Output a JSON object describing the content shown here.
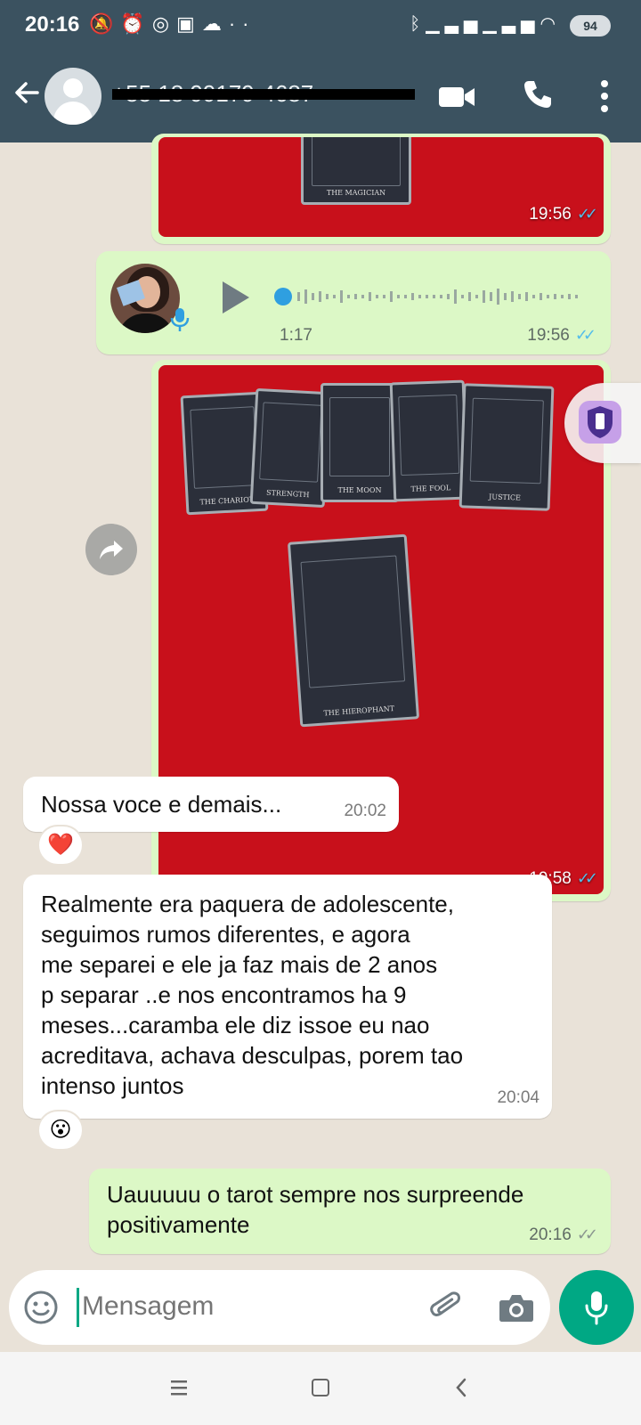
{
  "status_bar": {
    "time": "20:16",
    "battery": "94",
    "left_icons": [
      "bell-off-icon",
      "alarm-icon",
      "whatsapp-icon",
      "instagram-icon",
      "cloud-icon",
      "more-dots-icon"
    ],
    "right_icons": [
      "bluetooth-icon",
      "signal-icon",
      "signal-icon",
      "wifi-icon"
    ]
  },
  "header": {
    "contact_name": "+55 18 99179-4687",
    "icons": [
      "back-arrow-icon",
      "video-call-icon",
      "phone-call-icon",
      "more-vertical-icon"
    ]
  },
  "messages": [
    {
      "type": "image",
      "direction": "out",
      "time": "19:56",
      "status": "read",
      "card_labels": [
        "THE MAGICIAN"
      ]
    },
    {
      "type": "audio",
      "direction": "out",
      "duration": "1:17",
      "time": "19:56",
      "status": "read"
    },
    {
      "type": "image",
      "direction": "out",
      "time": "19:58",
      "status": "read",
      "card_labels": [
        "THE CHARIOT",
        "STRENGTH",
        "THE MOON",
        "THE FOOL",
        "JUSTICE",
        "THE HIEROPHANT"
      ]
    },
    {
      "type": "text",
      "direction": "in",
      "text": "Nossa voce e demais...",
      "time": "20:02",
      "reaction": "❤️"
    },
    {
      "type": "text",
      "direction": "in",
      "lines": [
        "Realmente era paquera de adolescente,",
        "seguimos rumos diferentes, e agora",
        "me separei e ele ja faz mais de 2 anos",
        "p separar ..e nos encontramos ha 9",
        "meses...caramba ele diz issoe eu nao",
        "acreditava, achava desculpas, porem tao",
        "intenso juntos"
      ],
      "time": "20:04",
      "reaction": "😮"
    },
    {
      "type": "text",
      "direction": "out",
      "lines": [
        "Uauuuuu o tarot sempre nos surpreende",
        "positivamente"
      ],
      "time": "20:16",
      "status": "delivered"
    }
  ],
  "composer": {
    "placeholder": "Mensagem",
    "icons": [
      "emoji-icon",
      "attach-icon",
      "camera-icon",
      "mic-icon"
    ]
  },
  "nav_bar": {
    "icons": [
      "recent-apps-icon",
      "home-icon",
      "back-icon"
    ]
  },
  "colors": {
    "header": "#3b5260",
    "outgoing_bubble": "#dcf8c6",
    "incoming_bubble": "#ffffff",
    "accent": "#00a884",
    "read_ticks": "#53bdeb",
    "photo_bg": "#c8101b"
  }
}
